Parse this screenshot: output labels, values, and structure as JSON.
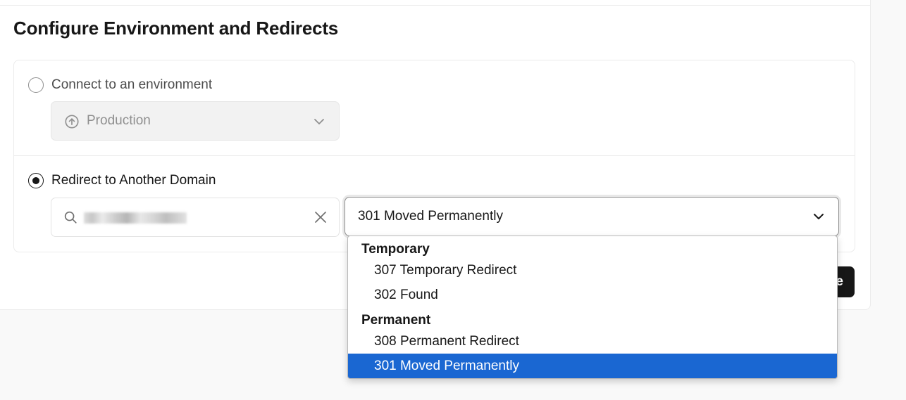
{
  "section": {
    "title": "Configure Environment and Redirects"
  },
  "options": {
    "environment": {
      "label": "Connect to an environment",
      "selected": false,
      "select_value": "Production",
      "select_icon": "arrow-up-circle-icon",
      "disabled": true
    },
    "redirect": {
      "label": "Redirect to Another Domain",
      "selected": true,
      "domain_input_value": "",
      "domain_input_obscured": true,
      "status_select_value": "301 Moved Permanently"
    }
  },
  "save_button": {
    "label": "Save",
    "visible_fragment": "e"
  },
  "dropdown": {
    "groups": [
      {
        "label": "Temporary",
        "items": [
          "307 Temporary Redirect",
          "302 Found"
        ]
      },
      {
        "label": "Permanent",
        "items": [
          "308 Permanent Redirect",
          "301 Moved Permanently"
        ]
      }
    ],
    "highlighted": "301 Moved Permanently"
  },
  "colors": {
    "highlight": "#1a67d2",
    "button_bg": "#171717",
    "border": "#ebebeb",
    "page_bg": "#f9f9f9"
  }
}
